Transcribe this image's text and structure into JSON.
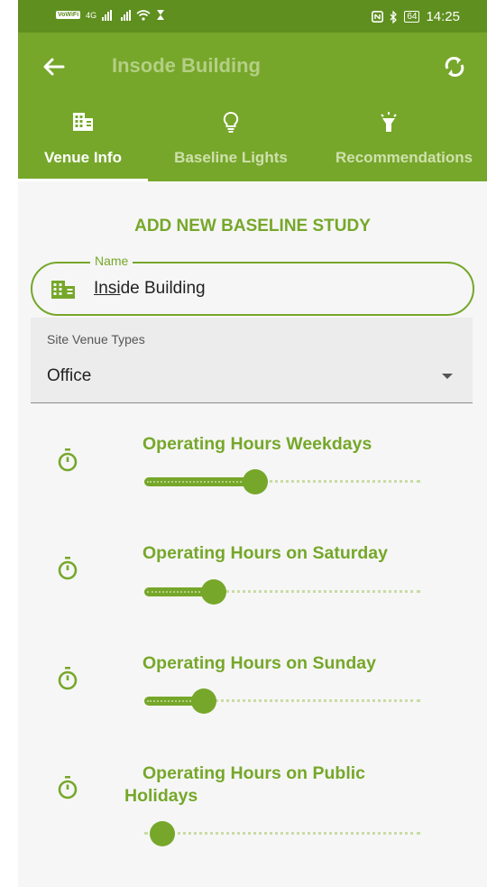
{
  "status": {
    "time": "14:25",
    "vowifi": "VoWiFi",
    "network": "4G",
    "battery": "64"
  },
  "appbar": {
    "title": "Insode Building"
  },
  "tabs": [
    {
      "label": "Venue Info",
      "selected": true
    },
    {
      "label": "Baseline Lights",
      "selected": false
    },
    {
      "label": "Recommendations",
      "selected": false
    }
  ],
  "form": {
    "heading": "ADD NEW BASELINE STUDY",
    "name_label": "Name",
    "name_value_underlined": "Insi",
    "name_value_rest": "de Building",
    "venue_type_label": "Site Venue Types",
    "venue_type_value": "Office"
  },
  "hours": [
    {
      "label": "Operating Hours Weekdays",
      "fraction": 0.36
    },
    {
      "label": "Operating Hours on Saturday",
      "fraction": 0.2
    },
    {
      "label": "Operating Hours on Sunday",
      "fraction": 0.16
    },
    {
      "label": "Operating Hours on Public Holidays",
      "fraction": 0.0
    }
  ],
  "colors": {
    "primary": "#76a72a",
    "primary_dark": "#5f8f1f",
    "light": "#c9dca5"
  }
}
